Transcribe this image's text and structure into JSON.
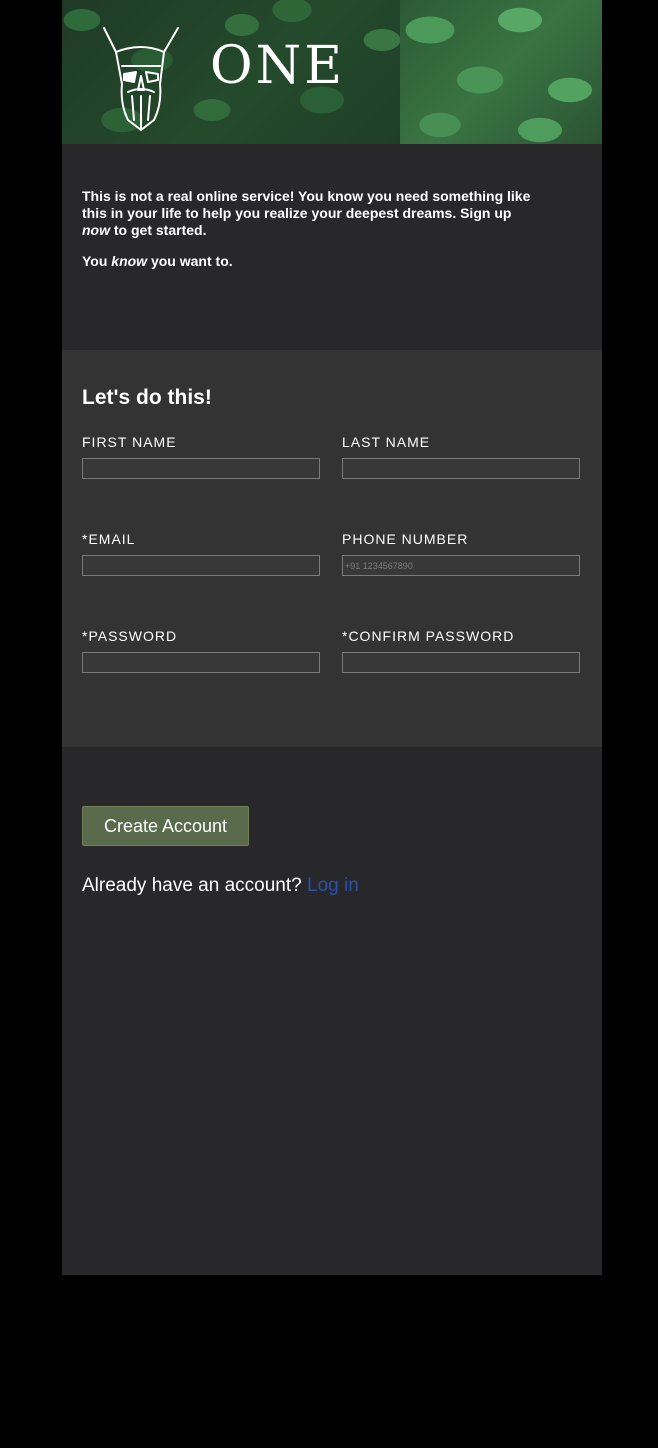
{
  "header": {
    "brand": "ONE"
  },
  "intro": {
    "p1_before": "This is not a real online service! You know you need something like this in your life to help you realize your deepest dreams. Sign up ",
    "p1_emphasis": "now",
    "p1_after": " to get started.",
    "p2_before": "You ",
    "p2_emphasis": "know",
    "p2_after": " you want to."
  },
  "form": {
    "title": "Let's do this!",
    "first_name_label": "FIRST NAME",
    "first_name_value": "",
    "last_name_label": "LAST NAME",
    "last_name_value": "",
    "email_label": "*EMAIL",
    "email_value": "",
    "phone_label": "PHONE NUMBER",
    "phone_placeholder": "+91 1234567890",
    "password_label": "*PASSWORD",
    "confirm_password_label": "*CONFIRM PASSWORD"
  },
  "actions": {
    "create_account_label": "Create Account",
    "login_prompt": "Already have an account?",
    "login_link": "Log in"
  },
  "colors": {
    "page_background": "#000000",
    "panel_dark": "#282829",
    "panel_form": "#333334",
    "button_background": "#5a6b4b",
    "link": "#2c4fae"
  },
  "icons": {
    "logo": "viking-helmet-logo-icon"
  }
}
